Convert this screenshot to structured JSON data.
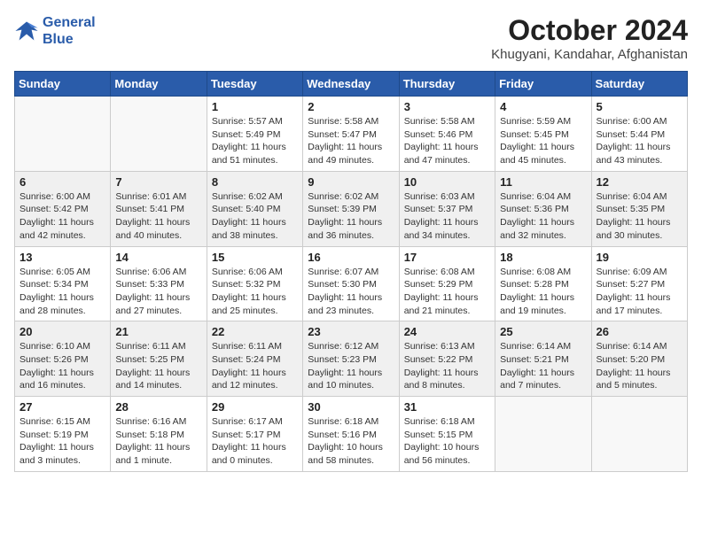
{
  "header": {
    "logo_line1": "General",
    "logo_line2": "Blue",
    "month": "October 2024",
    "location": "Khugyani, Kandahar, Afghanistan"
  },
  "days_of_week": [
    "Sunday",
    "Monday",
    "Tuesday",
    "Wednesday",
    "Thursday",
    "Friday",
    "Saturday"
  ],
  "weeks": [
    [
      {
        "num": "",
        "info": ""
      },
      {
        "num": "",
        "info": ""
      },
      {
        "num": "1",
        "info": "Sunrise: 5:57 AM\nSunset: 5:49 PM\nDaylight: 11 hours and 51 minutes."
      },
      {
        "num": "2",
        "info": "Sunrise: 5:58 AM\nSunset: 5:47 PM\nDaylight: 11 hours and 49 minutes."
      },
      {
        "num": "3",
        "info": "Sunrise: 5:58 AM\nSunset: 5:46 PM\nDaylight: 11 hours and 47 minutes."
      },
      {
        "num": "4",
        "info": "Sunrise: 5:59 AM\nSunset: 5:45 PM\nDaylight: 11 hours and 45 minutes."
      },
      {
        "num": "5",
        "info": "Sunrise: 6:00 AM\nSunset: 5:44 PM\nDaylight: 11 hours and 43 minutes."
      }
    ],
    [
      {
        "num": "6",
        "info": "Sunrise: 6:00 AM\nSunset: 5:42 PM\nDaylight: 11 hours and 42 minutes."
      },
      {
        "num": "7",
        "info": "Sunrise: 6:01 AM\nSunset: 5:41 PM\nDaylight: 11 hours and 40 minutes."
      },
      {
        "num": "8",
        "info": "Sunrise: 6:02 AM\nSunset: 5:40 PM\nDaylight: 11 hours and 38 minutes."
      },
      {
        "num": "9",
        "info": "Sunrise: 6:02 AM\nSunset: 5:39 PM\nDaylight: 11 hours and 36 minutes."
      },
      {
        "num": "10",
        "info": "Sunrise: 6:03 AM\nSunset: 5:37 PM\nDaylight: 11 hours and 34 minutes."
      },
      {
        "num": "11",
        "info": "Sunrise: 6:04 AM\nSunset: 5:36 PM\nDaylight: 11 hours and 32 minutes."
      },
      {
        "num": "12",
        "info": "Sunrise: 6:04 AM\nSunset: 5:35 PM\nDaylight: 11 hours and 30 minutes."
      }
    ],
    [
      {
        "num": "13",
        "info": "Sunrise: 6:05 AM\nSunset: 5:34 PM\nDaylight: 11 hours and 28 minutes."
      },
      {
        "num": "14",
        "info": "Sunrise: 6:06 AM\nSunset: 5:33 PM\nDaylight: 11 hours and 27 minutes."
      },
      {
        "num": "15",
        "info": "Sunrise: 6:06 AM\nSunset: 5:32 PM\nDaylight: 11 hours and 25 minutes."
      },
      {
        "num": "16",
        "info": "Sunrise: 6:07 AM\nSunset: 5:30 PM\nDaylight: 11 hours and 23 minutes."
      },
      {
        "num": "17",
        "info": "Sunrise: 6:08 AM\nSunset: 5:29 PM\nDaylight: 11 hours and 21 minutes."
      },
      {
        "num": "18",
        "info": "Sunrise: 6:08 AM\nSunset: 5:28 PM\nDaylight: 11 hours and 19 minutes."
      },
      {
        "num": "19",
        "info": "Sunrise: 6:09 AM\nSunset: 5:27 PM\nDaylight: 11 hours and 17 minutes."
      }
    ],
    [
      {
        "num": "20",
        "info": "Sunrise: 6:10 AM\nSunset: 5:26 PM\nDaylight: 11 hours and 16 minutes."
      },
      {
        "num": "21",
        "info": "Sunrise: 6:11 AM\nSunset: 5:25 PM\nDaylight: 11 hours and 14 minutes."
      },
      {
        "num": "22",
        "info": "Sunrise: 6:11 AM\nSunset: 5:24 PM\nDaylight: 11 hours and 12 minutes."
      },
      {
        "num": "23",
        "info": "Sunrise: 6:12 AM\nSunset: 5:23 PM\nDaylight: 11 hours and 10 minutes."
      },
      {
        "num": "24",
        "info": "Sunrise: 6:13 AM\nSunset: 5:22 PM\nDaylight: 11 hours and 8 minutes."
      },
      {
        "num": "25",
        "info": "Sunrise: 6:14 AM\nSunset: 5:21 PM\nDaylight: 11 hours and 7 minutes."
      },
      {
        "num": "26",
        "info": "Sunrise: 6:14 AM\nSunset: 5:20 PM\nDaylight: 11 hours and 5 minutes."
      }
    ],
    [
      {
        "num": "27",
        "info": "Sunrise: 6:15 AM\nSunset: 5:19 PM\nDaylight: 11 hours and 3 minutes."
      },
      {
        "num": "28",
        "info": "Sunrise: 6:16 AM\nSunset: 5:18 PM\nDaylight: 11 hours and 1 minute."
      },
      {
        "num": "29",
        "info": "Sunrise: 6:17 AM\nSunset: 5:17 PM\nDaylight: 11 hours and 0 minutes."
      },
      {
        "num": "30",
        "info": "Sunrise: 6:18 AM\nSunset: 5:16 PM\nDaylight: 10 hours and 58 minutes."
      },
      {
        "num": "31",
        "info": "Sunrise: 6:18 AM\nSunset: 5:15 PM\nDaylight: 10 hours and 56 minutes."
      },
      {
        "num": "",
        "info": ""
      },
      {
        "num": "",
        "info": ""
      }
    ]
  ]
}
